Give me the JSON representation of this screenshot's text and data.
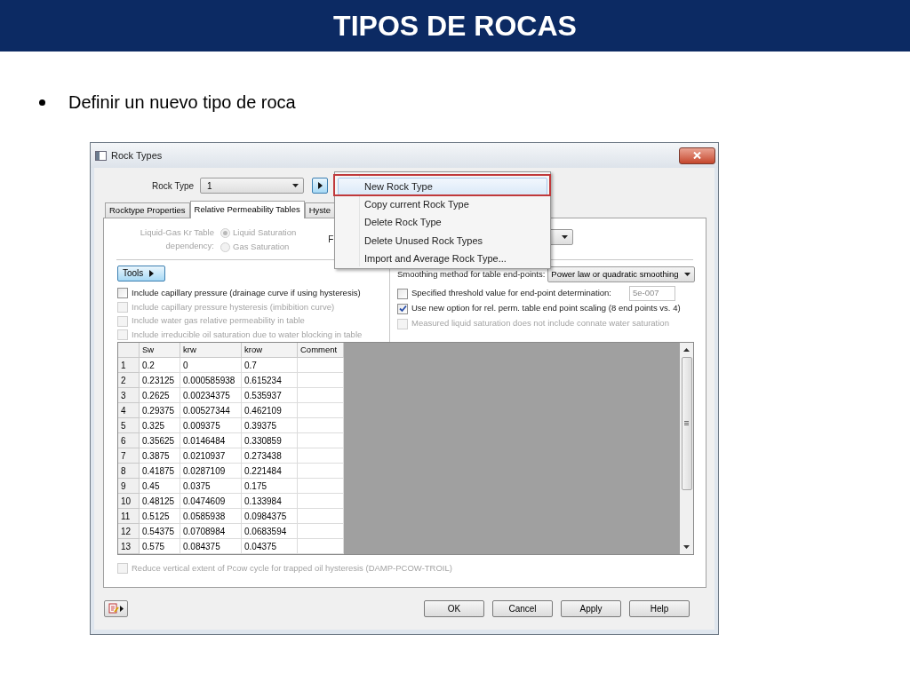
{
  "slide": {
    "title": "TIPOS DE ROCAS",
    "bullets": [
      "Definir un nuevo tipo de roca"
    ]
  },
  "dialog": {
    "title": "Rock Types",
    "rock_type": {
      "label": "Rock Type",
      "value": "1"
    },
    "tabs": [
      {
        "label": "Rocktype Properties",
        "selected": false
      },
      {
        "label": "Relative Permeability Tables",
        "selected": true
      },
      {
        "label": "Hyste",
        "selected": false
      }
    ],
    "menu": {
      "items": [
        {
          "label": "New Rock Type",
          "selected": true
        },
        {
          "label": "Copy current Rock Type",
          "selected": false
        },
        {
          "label": "Delete Rock Type",
          "selected": false
        },
        {
          "label": "Delete Unused Rock Types",
          "selected": false
        },
        {
          "label": "Import and Average Rock Type...",
          "selected": false
        }
      ]
    },
    "kr_dependency": {
      "label": "Liquid-Gas Kr Table\ndependency:",
      "disabled": true,
      "options": [
        {
          "label": "Liquid Saturation",
          "selected": true
        },
        {
          "label": "Gas Saturation",
          "selected": false
        }
      ]
    },
    "partial_label": "F",
    "tools_button": "Tools",
    "left_options": [
      {
        "label": "Include capillary pressure (drainage curve if using hysteresis)",
        "checked": false,
        "disabled": false
      },
      {
        "label": "Include capillary pressure hysteresis (imbibition curve)",
        "checked": false,
        "disabled": true
      },
      {
        "label": "Include water gas relative permeability in table",
        "checked": false,
        "disabled": true
      },
      {
        "label": "Include irreducible oil saturation due to water blocking in table",
        "checked": false,
        "disabled": true
      }
    ],
    "smoothing": {
      "label": "Smoothing method for table end-points:",
      "value": "Power law or quadratic smoothing"
    },
    "right_options": [
      {
        "label": "Specified threshold value for end-point determination:",
        "checked": false,
        "disabled": false,
        "field_value": "5e-007"
      },
      {
        "label": "Use new option for rel. perm. table end point scaling (8 end points vs. 4)",
        "checked": true,
        "disabled": false
      },
      {
        "label": "Measured liquid saturation does not include connate water saturation",
        "checked": false,
        "disabled": true
      }
    ],
    "table": {
      "columns": [
        "Sw",
        "krw",
        "krow",
        "Comment"
      ],
      "rows": [
        {
          "number": "1",
          "cells": [
            "0.2",
            "0",
            "0.7"
          ]
        },
        {
          "number": "2",
          "cells": [
            "0.23125",
            "0.000585938",
            "0.615234"
          ]
        },
        {
          "number": "3",
          "cells": [
            "0.2625",
            "0.00234375",
            "0.535937"
          ]
        },
        {
          "number": "4",
          "cells": [
            "0.29375",
            "0.00527344",
            "0.462109"
          ]
        },
        {
          "number": "5",
          "cells": [
            "0.325",
            "0.009375",
            "0.39375"
          ]
        },
        {
          "number": "6",
          "cells": [
            "0.35625",
            "0.0146484",
            "0.330859"
          ]
        },
        {
          "number": "7",
          "cells": [
            "0.3875",
            "0.0210937",
            "0.273438"
          ]
        },
        {
          "number": "8",
          "cells": [
            "0.41875",
            "0.0287109",
            "0.221484"
          ]
        },
        {
          "number": "9",
          "cells": [
            "0.45",
            "0.0375",
            "0.175"
          ]
        },
        {
          "number": "10",
          "cells": [
            "0.48125",
            "0.0474609",
            "0.133984"
          ]
        },
        {
          "number": "11",
          "cells": [
            "0.5125",
            "0.0585938",
            "0.0984375"
          ]
        },
        {
          "number": "12",
          "cells": [
            "0.54375",
            "0.0708984",
            "0.0683594"
          ]
        },
        {
          "number": "13",
          "cells": [
            "0.575",
            "0.084375",
            "0.04375"
          ]
        }
      ]
    },
    "bottom_option": {
      "label": "Reduce vertical extent of Pcow cycle for trapped oil hysteresis (DAMP-PCOW-TROIL)",
      "checked": false,
      "disabled": true
    },
    "buttons": [
      "OK",
      "Cancel",
      "Apply",
      "Help"
    ]
  }
}
